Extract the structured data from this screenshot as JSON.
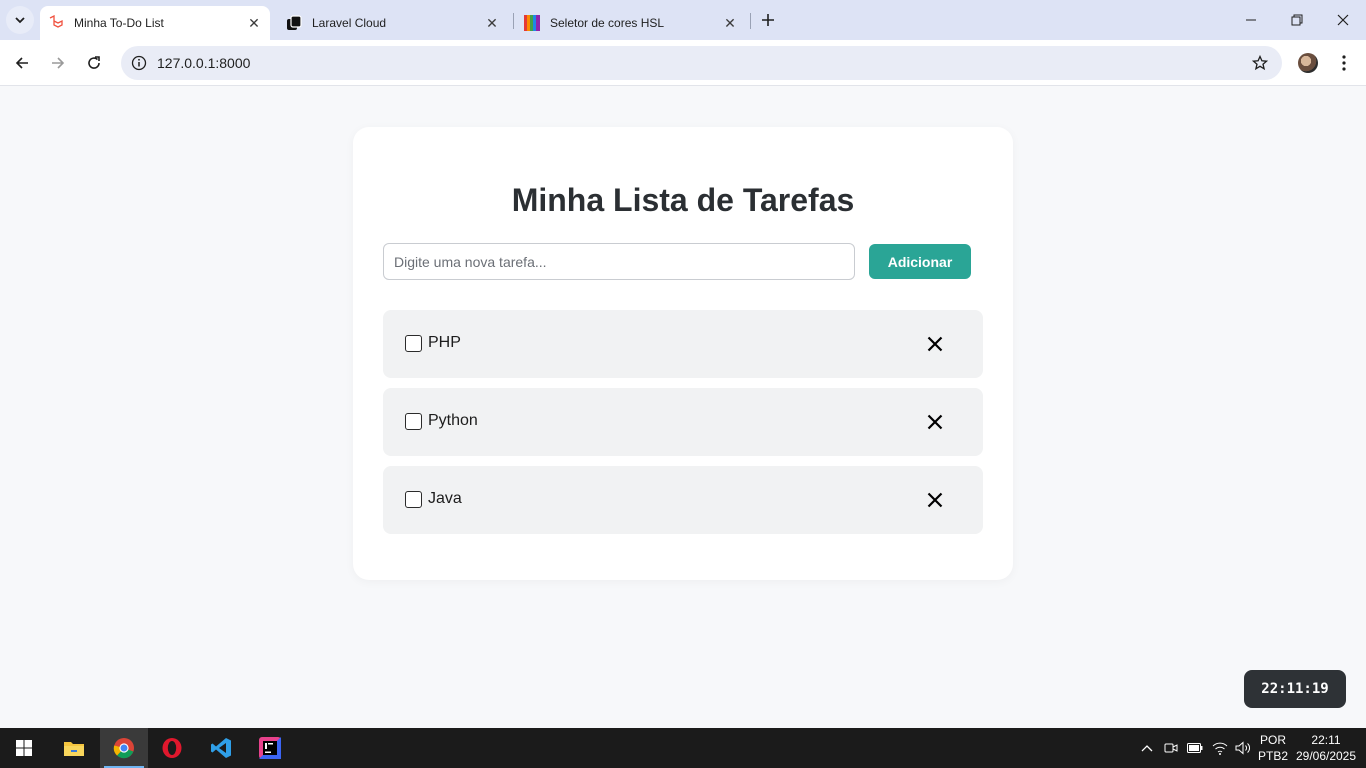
{
  "browser": {
    "tabs": [
      {
        "title": "Minha To-Do List",
        "active": true
      },
      {
        "title": "Laravel Cloud",
        "active": false
      },
      {
        "title": "Seletor de cores HSL",
        "active": false
      }
    ],
    "url": "127.0.0.1:8000"
  },
  "app": {
    "heading": "Minha Lista de Tarefas",
    "input_placeholder": "Digite uma nova tarefa...",
    "input_value": "",
    "add_button": "Adicionar",
    "tasks": [
      {
        "label": "PHP",
        "done": false
      },
      {
        "label": "Python",
        "done": false
      },
      {
        "label": "Java",
        "done": false
      }
    ],
    "clock": "22:11:19"
  },
  "taskbar": {
    "language": "POR",
    "layout": "PTB2",
    "time": "22:11",
    "date": "29/06/2025"
  },
  "colors": {
    "accent": "#2aa596",
    "card": "#ffffff",
    "page_bg": "#f7f8fa",
    "task_bg": "#f1f2f3"
  }
}
